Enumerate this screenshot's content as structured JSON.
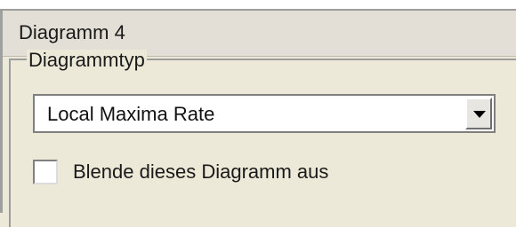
{
  "header": {
    "title": "Diagramm 4"
  },
  "group": {
    "legend": "Diagrammtyp"
  },
  "combo": {
    "selected": "Local Maxima Rate",
    "icon": "chevron-down-icon"
  },
  "checkbox": {
    "label": "Blende dieses Diagramm aus",
    "checked": false
  }
}
